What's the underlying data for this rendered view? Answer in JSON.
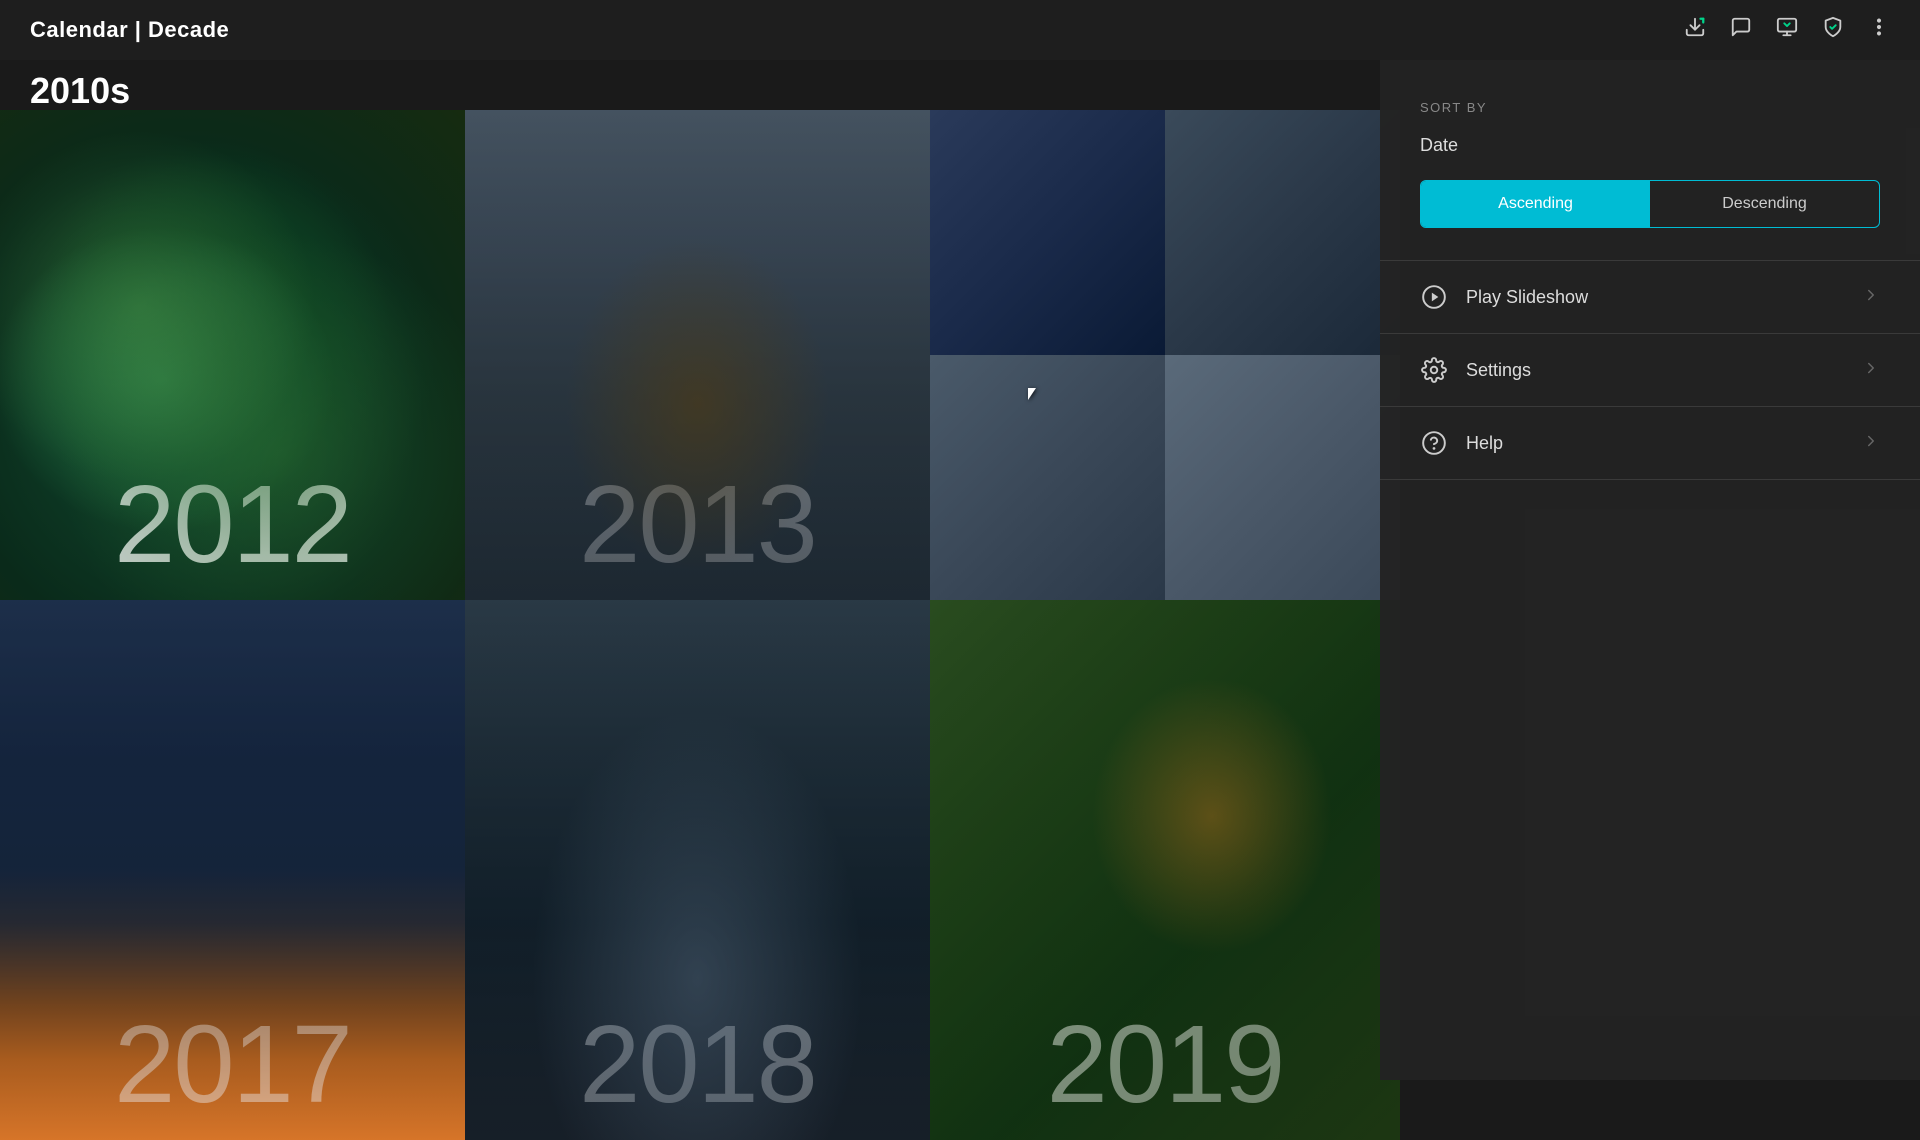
{
  "header": {
    "title": "Calendar | Decade",
    "icons": [
      "download-icon",
      "message-icon",
      "monitor-icon",
      "shield-icon",
      "more-icon"
    ]
  },
  "decade": {
    "label": "2010s"
  },
  "grid": {
    "years": [
      "2012",
      "2013",
      "2017",
      "2018",
      "2019"
    ]
  },
  "panel": {
    "sort_by_label": "SORT BY",
    "date_label": "Date",
    "ascending_label": "Ascending",
    "descending_label": "Descending",
    "menu_items": [
      {
        "id": "slideshow",
        "label": "Play Slideshow",
        "icon": "play-icon"
      },
      {
        "id": "settings",
        "label": "Settings",
        "icon": "settings-icon"
      },
      {
        "id": "help",
        "label": "Help",
        "icon": "help-icon"
      }
    ]
  }
}
